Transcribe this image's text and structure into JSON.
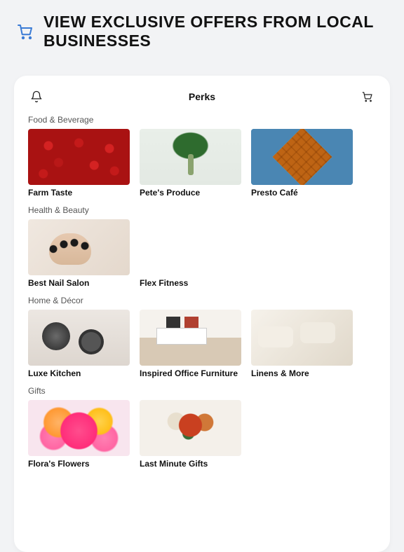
{
  "banner": {
    "title": "VIEW EXCLUSIVE OFFERS FROM LOCAL BUSINESSES"
  },
  "topbar": {
    "title": "Perks"
  },
  "sections": [
    {
      "title": "Food & Beverage",
      "items": [
        {
          "label": "Farm Taste"
        },
        {
          "label": "Pete's Produce"
        },
        {
          "label": "Presto Café"
        }
      ]
    },
    {
      "title": "Health & Beauty",
      "items": [
        {
          "label": "Best Nail Salon"
        },
        {
          "label": "Flex Fitness"
        }
      ]
    },
    {
      "title": "Home & Décor",
      "items": [
        {
          "label": "Luxe Kitchen"
        },
        {
          "label": "Inspired Office Furniture"
        },
        {
          "label": "Linens & More"
        }
      ]
    },
    {
      "title": "Gifts",
      "items": [
        {
          "label": "Flora's Flowers"
        },
        {
          "label": "Last Minute Gifts"
        }
      ]
    }
  ]
}
